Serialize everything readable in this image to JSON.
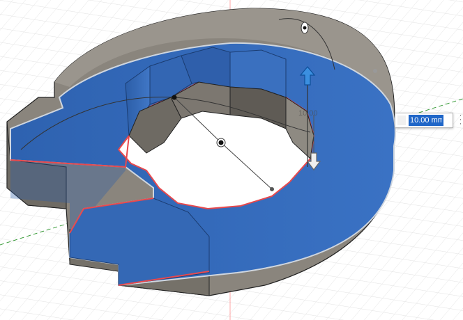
{
  "scene": {
    "model_color": "#8c877f",
    "selected_face_color": "#2f68b5",
    "grid_color": "#e4e4e4",
    "edge_highlight_color": "#e8494d"
  },
  "manipulator": {
    "arrow_up_icon": "arrow-up-icon",
    "arrow_down_icon": "arrow-down-icon",
    "ghost_value": "10.00",
    "input_value": "10.00 mm",
    "menu_icon": "vertical-dots-icon"
  }
}
